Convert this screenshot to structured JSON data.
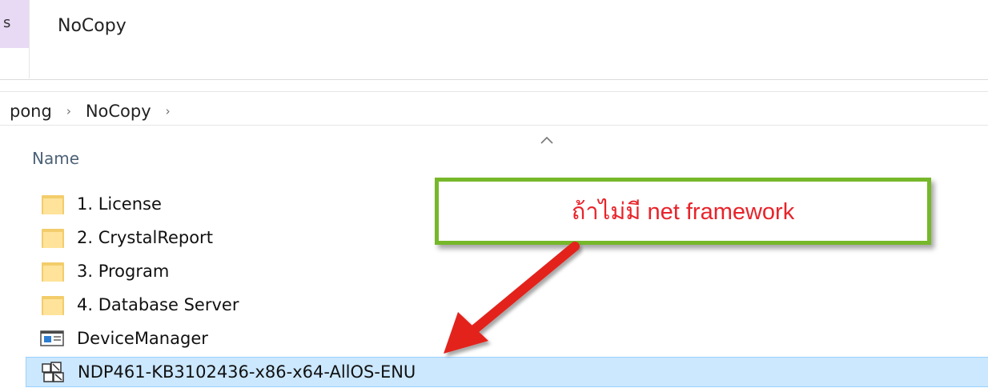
{
  "window": {
    "title_prefix_fragment": "s",
    "title": "NoCopy"
  },
  "breadcrumb": {
    "items": [
      "pong",
      "NoCopy"
    ],
    "separator": "›"
  },
  "file_list": {
    "column_name": "Name",
    "items": [
      {
        "label": "1. License",
        "type": "folder",
        "icon": "folder-icon"
      },
      {
        "label": "2. CrystalReport",
        "type": "folder",
        "icon": "folder-icon"
      },
      {
        "label": "3. Program",
        "type": "folder",
        "icon": "folder-icon"
      },
      {
        "label": "4. Database Server",
        "type": "folder",
        "icon": "folder-icon"
      },
      {
        "label": "DeviceManager",
        "type": "application",
        "icon": "app-window-icon"
      },
      {
        "label": "NDP461-KB3102436-x86-x64-AllOS-ENU",
        "type": "installer",
        "icon": "installer-icon",
        "selected": true
      }
    ]
  },
  "annotation": {
    "text": "ถ้าไม่มี net framework",
    "border_color": "#76b82a",
    "text_color": "#e8232a",
    "arrow_color": "#e3231b"
  },
  "colors": {
    "selection_bg": "#cce8ff",
    "selection_border": "#99d1ff",
    "folder": "#f3cd6b",
    "header_text": "#4d6277"
  }
}
